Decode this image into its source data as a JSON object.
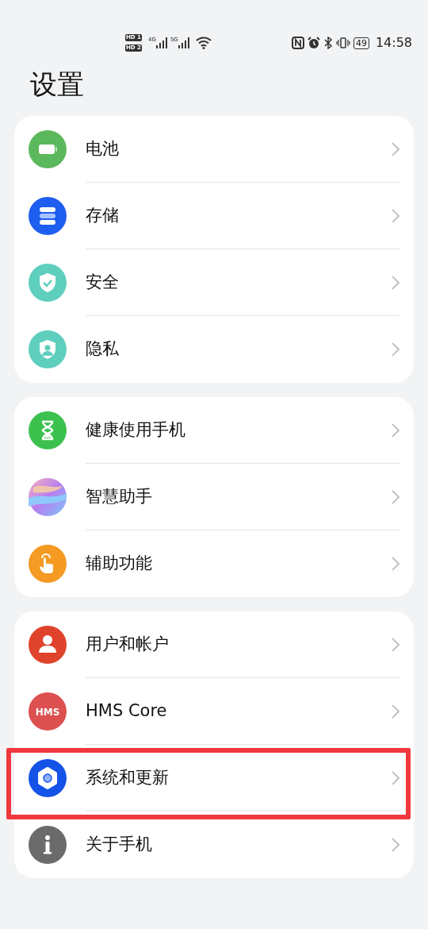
{
  "status_bar": {
    "sim_labels": [
      "HD 1",
      "HD 2"
    ],
    "networks": [
      "4G",
      "5G"
    ],
    "battery": "49",
    "time": "14:58"
  },
  "title": "设置",
  "groups": [
    {
      "items": [
        {
          "label": "电池",
          "kind": "battery",
          "color": "#5cb85c",
          "highlighted": false
        },
        {
          "label": "存储",
          "kind": "storage",
          "color": "#1e5ef0",
          "highlighted": false
        },
        {
          "label": "安全",
          "kind": "security",
          "color": "#5fcfbd",
          "highlighted": false
        },
        {
          "label": "隐私",
          "kind": "privacy",
          "color": "#5fcfbd",
          "highlighted": false
        }
      ]
    },
    {
      "items": [
        {
          "label": "健康使用手机",
          "kind": "health",
          "color": "#3cc14f",
          "highlighted": false
        },
        {
          "label": "智慧助手",
          "kind": "assistant",
          "highlighted": false
        },
        {
          "label": "辅助功能",
          "kind": "accessibility",
          "color": "#f59a23",
          "highlighted": false
        }
      ]
    },
    {
      "items": [
        {
          "label": "用户和帐户",
          "kind": "user",
          "color": "#e0432b",
          "highlighted": false
        },
        {
          "label": "HMS Core",
          "kind": "hms",
          "color": "#dc5050",
          "icon_text": "HMS",
          "highlighted": false
        },
        {
          "label": "系统和更新",
          "kind": "system",
          "color": "#1553e8",
          "highlighted": true
        },
        {
          "label": "关于手机",
          "kind": "about",
          "color": "#6b6b6b",
          "highlighted": false
        }
      ]
    }
  ]
}
